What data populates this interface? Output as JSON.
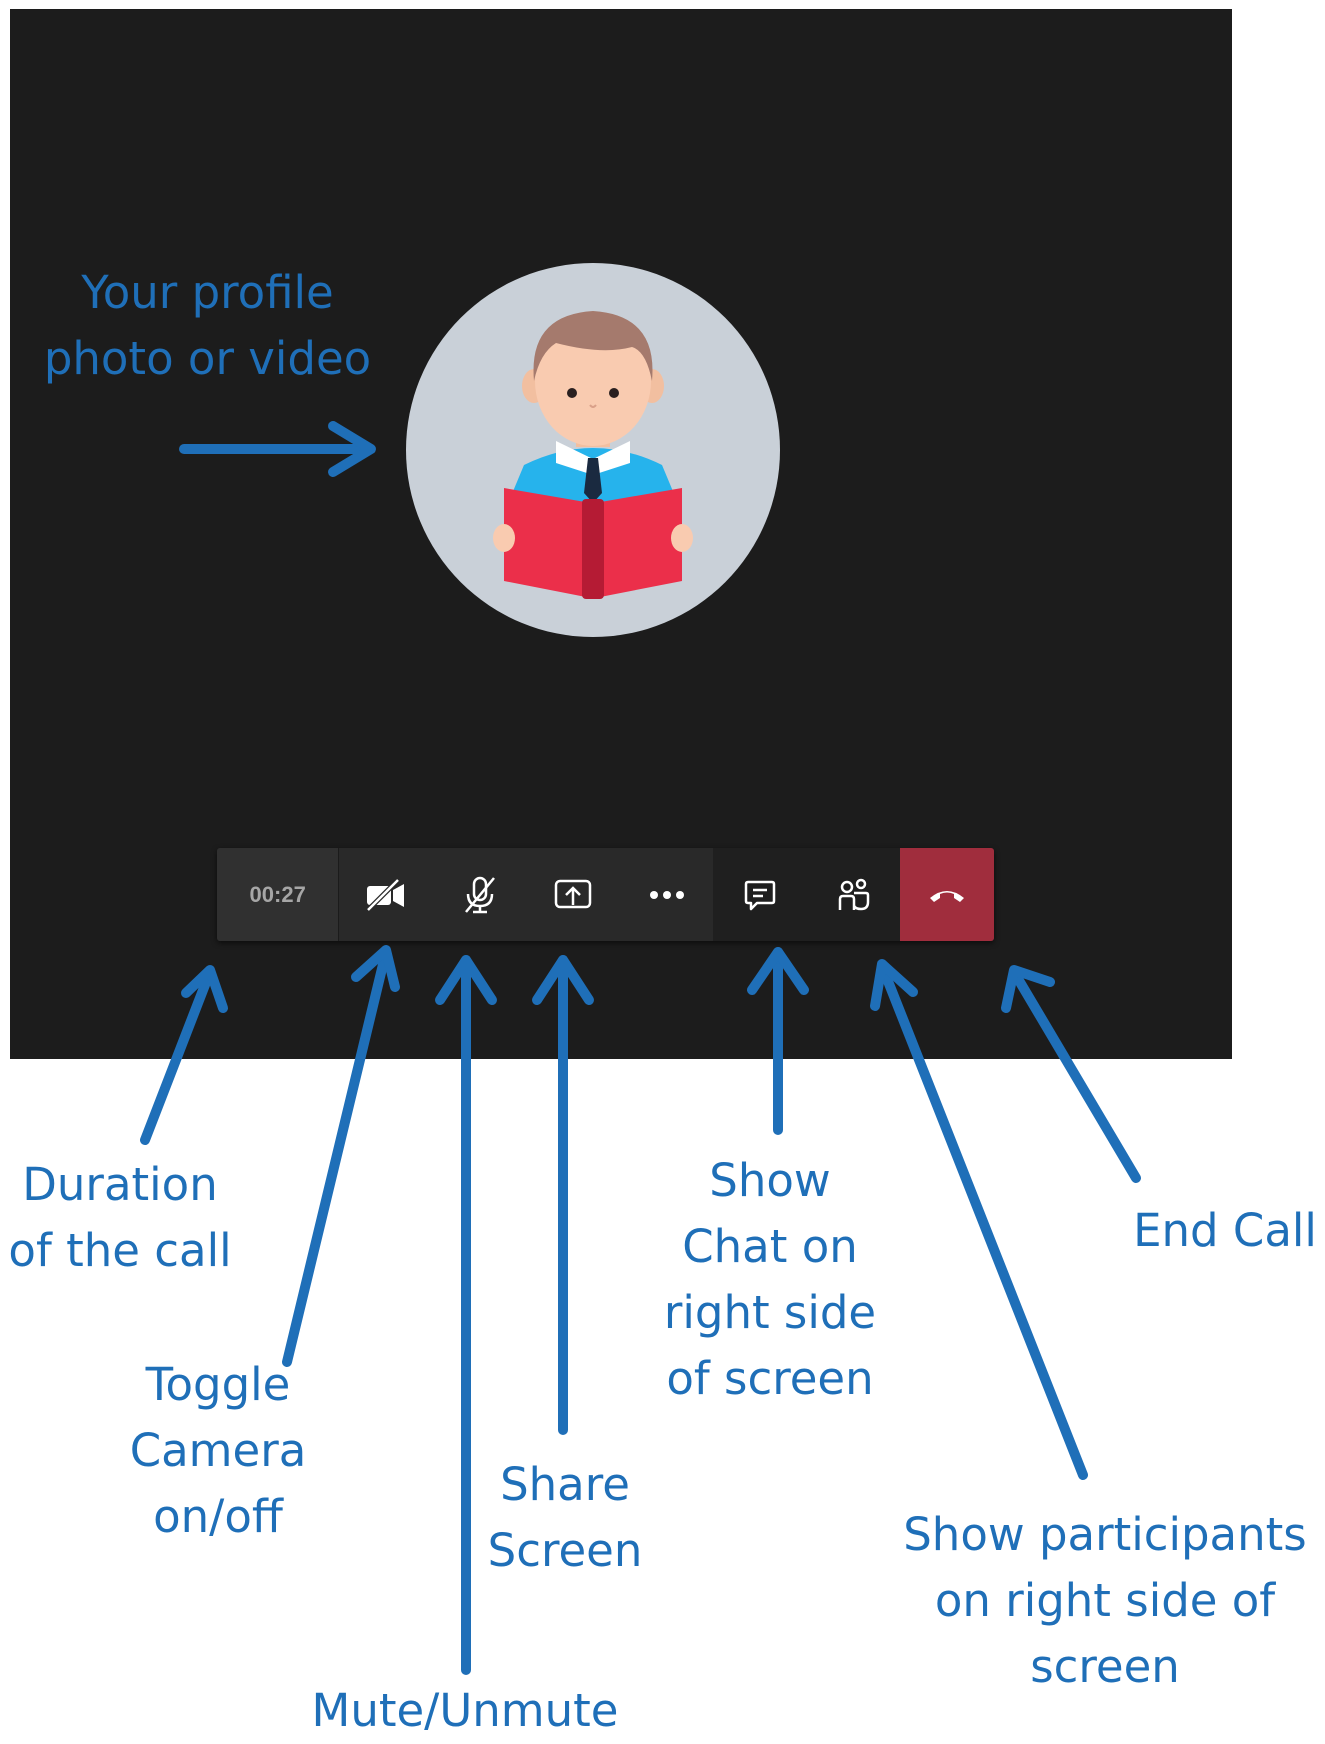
{
  "toolbar": {
    "duration": "00:27",
    "buttons": [
      {
        "name": "camera-off-icon"
      },
      {
        "name": "mic-off-icon"
      },
      {
        "name": "share-screen-icon"
      },
      {
        "name": "more-options-icon"
      },
      {
        "name": "chat-icon"
      },
      {
        "name": "participants-icon"
      },
      {
        "name": "hang-up-icon"
      }
    ]
  },
  "labels": {
    "profile": [
      "Your profile",
      "photo or video"
    ],
    "duration": [
      "Duration",
      "of the call"
    ],
    "camera": [
      "Toggle",
      "Camera",
      "on/off"
    ],
    "mute": "Mute/Unmute",
    "share": [
      "Share",
      "Screen"
    ],
    "chat": [
      "Show",
      "Chat on",
      "right side",
      "of screen"
    ],
    "participants": [
      "Show participants",
      "on right side of",
      "screen"
    ],
    "end": "End Call"
  },
  "colors": {
    "annotation": "#1f6fb8",
    "screen_background": "#1c1c1c",
    "toolbar": "#292929",
    "end_call": "#a02d3d",
    "avatar_circle": "#c9d0d8"
  }
}
